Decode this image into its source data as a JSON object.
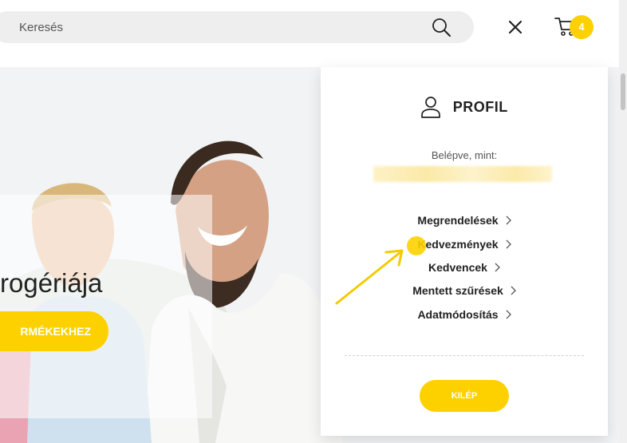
{
  "search": {
    "placeholder": "Keresés"
  },
  "cart": {
    "count": "4"
  },
  "hero": {
    "title": "rogériája",
    "button": "RMÉKEKHEZ"
  },
  "profile": {
    "title": "PROFIL",
    "logged_in_label": "Belépve, mint:",
    "menu": [
      {
        "label": "Megrendelések"
      },
      {
        "label": "Kedvezmények"
      },
      {
        "label": "Kedvencek"
      },
      {
        "label": "Mentett szűrések"
      },
      {
        "label": "Adatmódosítás"
      }
    ],
    "logout": "KILÉP"
  },
  "icons": {
    "search": "search-icon",
    "close": "close-icon",
    "cart": "cart-icon",
    "user": "user-icon",
    "chevron": "chevron-right-icon"
  },
  "colors": {
    "accent": "#fdd100",
    "text": "#222222",
    "muted": "#555555"
  }
}
